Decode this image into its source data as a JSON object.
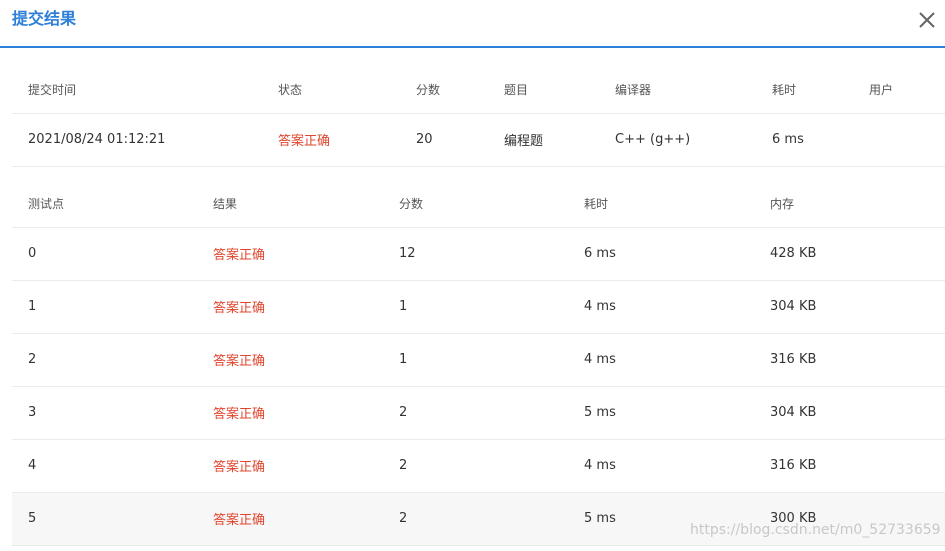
{
  "dialog": {
    "title": "提交结果",
    "close_label": "×"
  },
  "summary": {
    "headers": [
      "提交时间",
      "状态",
      "分数",
      "题目",
      "编译器",
      "耗时",
      "用户"
    ],
    "row": {
      "submit_time": "2021/08/24 01:12:21",
      "status": "答案正确",
      "score": "20",
      "problem": "编程题",
      "compiler": "C++ (g++)",
      "time": "6 ms",
      "user": ""
    }
  },
  "cases": {
    "headers": [
      "测试点",
      "结果",
      "分数",
      "耗时",
      "内存"
    ],
    "rows": [
      {
        "id": "0",
        "result": "答案正确",
        "score": "12",
        "time": "6 ms",
        "memory": "428 KB"
      },
      {
        "id": "1",
        "result": "答案正确",
        "score": "1",
        "time": "4 ms",
        "memory": "304 KB"
      },
      {
        "id": "2",
        "result": "答案正确",
        "score": "1",
        "time": "4 ms",
        "memory": "316 KB"
      },
      {
        "id": "3",
        "result": "答案正确",
        "score": "2",
        "time": "5 ms",
        "memory": "304 KB"
      },
      {
        "id": "4",
        "result": "答案正确",
        "score": "2",
        "time": "4 ms",
        "memory": "316 KB"
      },
      {
        "id": "5",
        "result": "答案正确",
        "score": "2",
        "time": "5 ms",
        "memory": "300 KB"
      }
    ]
  },
  "watermark": "https://blog.csdn.net/m0_52733659",
  "colors": {
    "accent": "#2d7fd8",
    "success_text": "#e0452e"
  }
}
